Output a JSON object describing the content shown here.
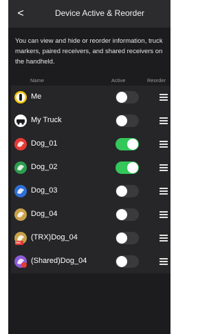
{
  "header": {
    "back_glyph": "<",
    "title": "Device Active & Reorder"
  },
  "description": "You can view and hide or reorder information, truck markers, paired receivers, and shared receivers on the handheld.",
  "columns": {
    "name": "Name",
    "active": "Active",
    "reorder": "Reorder"
  },
  "items": [
    {
      "label": "Me",
      "active": false,
      "icon": "person-pin-icon",
      "color": "#f5c400"
    },
    {
      "label": "My Truck",
      "active": false,
      "icon": "truck-pin-icon",
      "color": "#ffffff"
    },
    {
      "label": "Dog_01",
      "active": true,
      "icon": "dog-pin-icon",
      "color": "#e53935"
    },
    {
      "label": "Dog_02",
      "active": true,
      "icon": "dog-pin-icon",
      "color": "#2e9e4f"
    },
    {
      "label": "Dog_03",
      "active": false,
      "icon": "dog-pin-icon",
      "color": "#2f6fd6"
    },
    {
      "label": "Dog_04",
      "active": false,
      "icon": "dog-pin-icon",
      "color": "#c9a14a"
    },
    {
      "label": "(TRX)Dog_04",
      "active": false,
      "icon": "trx-dog-pin-icon",
      "color": "#c9a14a",
      "badge": "TRX",
      "badge_color": "#e53935"
    },
    {
      "label": "(Shared)Dog_04",
      "active": false,
      "icon": "shared-dog-pin-icon",
      "color": "#8e5bd6",
      "badge_color": "#e53935"
    }
  ],
  "colors": {
    "background": "#1c1c1e",
    "header": "#2c2c2e",
    "row": "#262628",
    "toggle_on": "#34c759",
    "toggle_off": "#3a3a3c"
  }
}
